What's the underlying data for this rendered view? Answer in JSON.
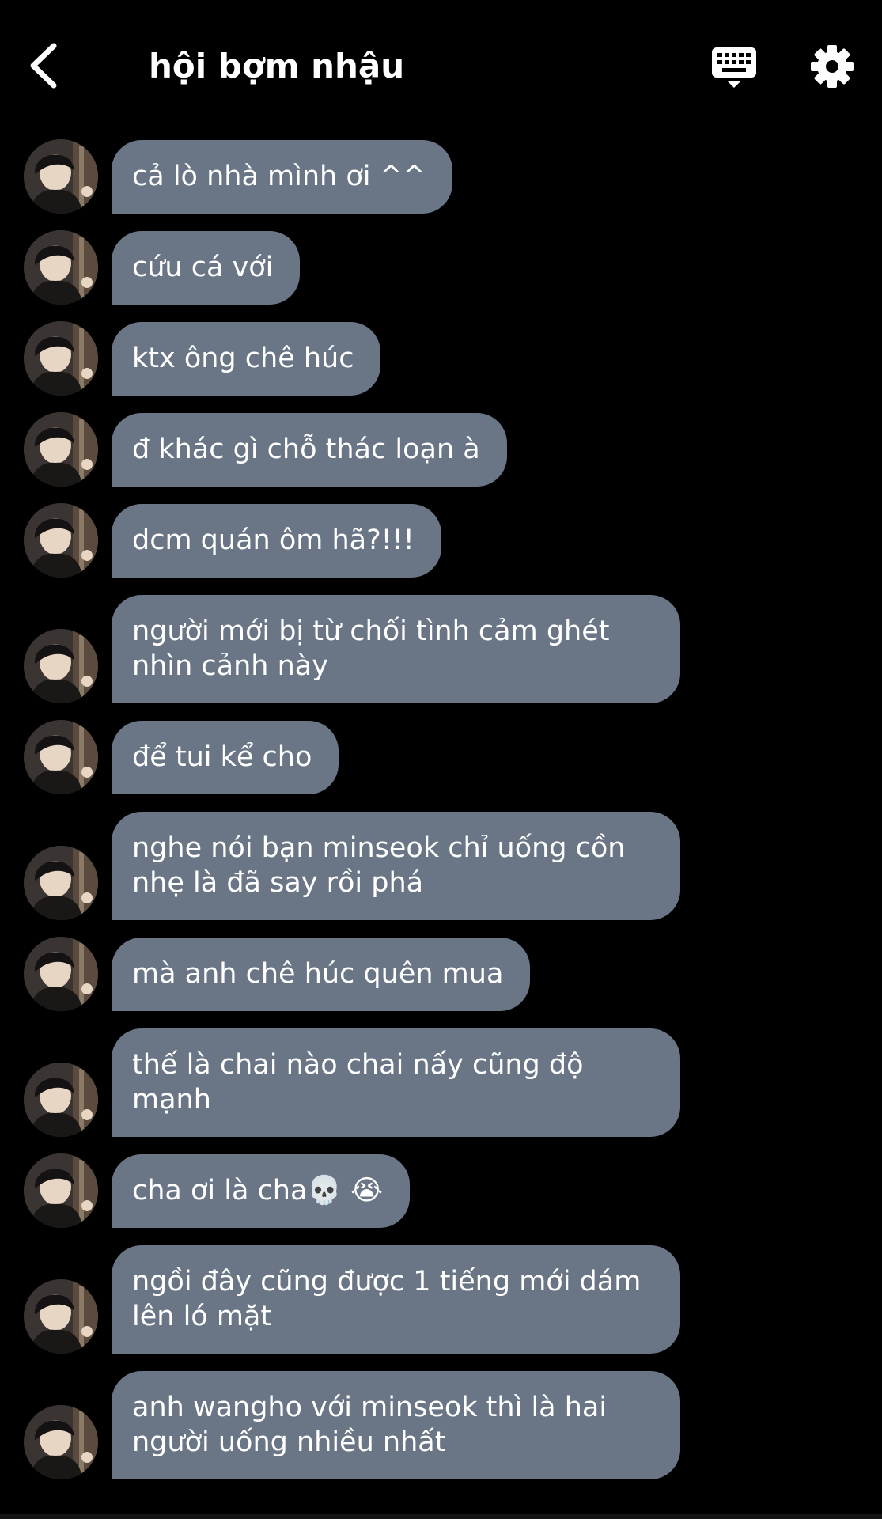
{
  "header": {
    "title": "hội bợm nhậu",
    "back_icon": "chevron-left-icon",
    "keyboard_icon": "keyboard-icon",
    "settings_icon": "gear-icon"
  },
  "colors": {
    "background": "#000000",
    "bubble": "#6a7686",
    "text": "#ffffff"
  },
  "messages": [
    {
      "text": "cả lò nhà mình ơi ^^"
    },
    {
      "text": "cứu cá với"
    },
    {
      "text": "ktx ông chê húc"
    },
    {
      "text": "đ khác gì chỗ thác loạn à"
    },
    {
      "text": "dcm quán ôm hã?!!!"
    },
    {
      "text": "người mới bị từ chối tình cảm ghét nhìn cảnh này"
    },
    {
      "text": "để tui kể cho"
    },
    {
      "text": "nghe nói bạn minseok chỉ uống cồn nhẹ là đã say rồi phá"
    },
    {
      "text": "mà anh chê húc quên mua"
    },
    {
      "text": "thế là chai nào chai nấy cũng độ mạnh"
    },
    {
      "text": "cha ơi là cha💀 😭"
    },
    {
      "text": "ngồi đây cũng được 1 tiếng mới dám lên ló mặt"
    },
    {
      "text": "anh wangho với minseok thì là hai người uống nhiều nhất"
    }
  ]
}
